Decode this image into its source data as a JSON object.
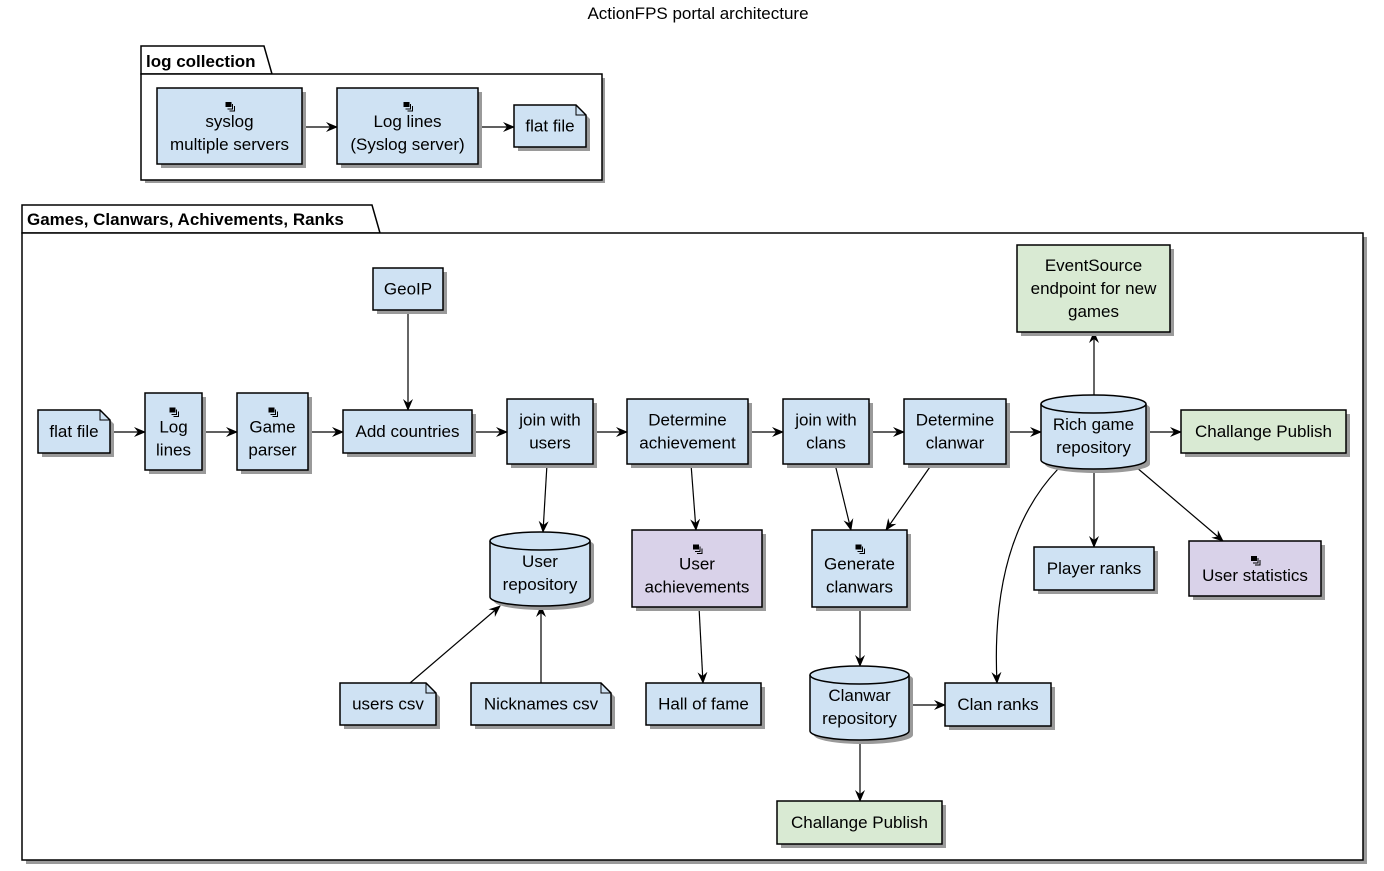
{
  "title": "ActionFPS portal architecture",
  "colors": {
    "node_blue": "#cfe2f3",
    "node_green": "#d9ead3",
    "node_purple": "#d9d2e9",
    "stroke": "#000000",
    "shadow": "#9a9a9a"
  },
  "packages": {
    "log_collection": {
      "label": "log collection"
    },
    "games": {
      "label": "Games, Clanwars, Achivements, Ranks"
    }
  },
  "nodes": {
    "syslog": {
      "lines": [
        "syslog",
        "multiple servers"
      ],
      "icon": "component-icon"
    },
    "loglines_syslog": {
      "lines": [
        "Log lines",
        "(Syslog server)"
      ],
      "icon": "component-icon"
    },
    "flatfile1": {
      "lines": [
        "flat file"
      ]
    },
    "flatfile2": {
      "lines": [
        "flat file"
      ]
    },
    "loglines": {
      "lines": [
        "Log",
        "lines"
      ],
      "icon": "component-icon"
    },
    "gameparser": {
      "lines": [
        "Game",
        "parser"
      ],
      "icon": "component-icon"
    },
    "geoip": {
      "lines": [
        "GeoIP"
      ]
    },
    "addcountries": {
      "lines": [
        "Add countries"
      ]
    },
    "joinusers": {
      "lines": [
        "join with",
        "users"
      ]
    },
    "determineach": {
      "lines": [
        "Determine",
        "achievement"
      ]
    },
    "joinclans": {
      "lines": [
        "join with",
        "clans"
      ]
    },
    "determinecw": {
      "lines": [
        "Determine",
        "clanwar"
      ]
    },
    "richrepo": {
      "lines": [
        "Rich game",
        "repository"
      ]
    },
    "eventsource": {
      "lines": [
        "EventSource",
        "endpoint for new",
        "games"
      ]
    },
    "challange1": {
      "lines": [
        "Challange Publish"
      ]
    },
    "userrepo": {
      "lines": [
        "User",
        "repository"
      ]
    },
    "userach": {
      "lines": [
        "User",
        "achievements"
      ],
      "icon": "component-icon"
    },
    "gencw": {
      "lines": [
        "Generate",
        "clanwars"
      ],
      "icon": "component-icon"
    },
    "playerranks": {
      "lines": [
        "Player ranks"
      ]
    },
    "userstats": {
      "lines": [
        "User statistics"
      ],
      "icon": "component-icon"
    },
    "userscsv": {
      "lines": [
        "users csv"
      ]
    },
    "nickcsv": {
      "lines": [
        "Nicknames csv"
      ]
    },
    "halloffame": {
      "lines": [
        "Hall of fame"
      ]
    },
    "cwrepo": {
      "lines": [
        "Clanwar",
        "repository"
      ]
    },
    "clanranks": {
      "lines": [
        "Clan ranks"
      ]
    },
    "challange2": {
      "lines": [
        "Challange Publish"
      ]
    }
  },
  "edges": [
    {
      "from": "syslog",
      "to": "loglines_syslog"
    },
    {
      "from": "loglines_syslog",
      "to": "flatfile1"
    },
    {
      "from": "flatfile2",
      "to": "loglines"
    },
    {
      "from": "loglines",
      "to": "gameparser"
    },
    {
      "from": "gameparser",
      "to": "addcountries"
    },
    {
      "from": "geoip",
      "to": "addcountries"
    },
    {
      "from": "addcountries",
      "to": "joinusers"
    },
    {
      "from": "joinusers",
      "to": "determineach"
    },
    {
      "from": "determineach",
      "to": "joinclans"
    },
    {
      "from": "joinclans",
      "to": "determinecw"
    },
    {
      "from": "determinecw",
      "to": "richrepo"
    },
    {
      "from": "richrepo",
      "to": "challange1"
    },
    {
      "from": "richrepo",
      "to": "eventsource"
    },
    {
      "from": "joinusers",
      "to": "userrepo"
    },
    {
      "from": "userscsv",
      "to": "userrepo"
    },
    {
      "from": "nickcsv",
      "to": "userrepo"
    },
    {
      "from": "determineach",
      "to": "userach"
    },
    {
      "from": "userach",
      "to": "halloffame"
    },
    {
      "from": "joinclans",
      "to": "gencw"
    },
    {
      "from": "determinecw",
      "to": "gencw"
    },
    {
      "from": "gencw",
      "to": "cwrepo"
    },
    {
      "from": "cwrepo",
      "to": "clanranks"
    },
    {
      "from": "cwrepo",
      "to": "challange2"
    },
    {
      "from": "richrepo",
      "to": "clanranks"
    },
    {
      "from": "richrepo",
      "to": "playerranks"
    },
    {
      "from": "richrepo",
      "to": "userstats"
    }
  ]
}
